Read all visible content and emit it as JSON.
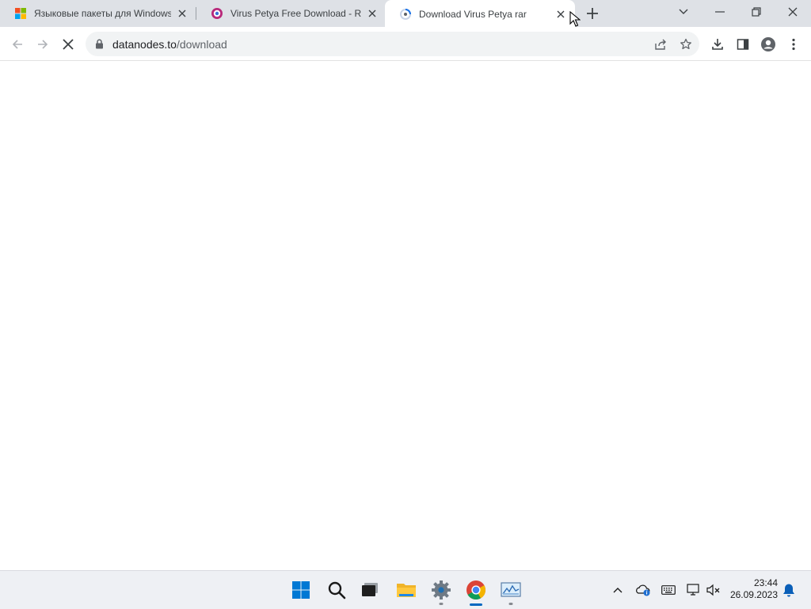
{
  "browser": {
    "tabs": [
      {
        "title": "Языковые пакеты для Windows",
        "active": false,
        "favicon": "windows-logo-icon"
      },
      {
        "title": "Virus Petya Free Download - Rep",
        "active": false,
        "favicon": "site-favicon-icon"
      },
      {
        "title": "Download Virus Petya rar",
        "active": true,
        "favicon": "loading-favicon-icon"
      }
    ],
    "new_tab_icon": "plus-icon",
    "address_bar": {
      "domain": "datanodes.to",
      "path": "/download"
    }
  },
  "taskbar": {
    "apps": [
      "windows-start-icon",
      "search-icon",
      "terminal-icon",
      "file-explorer-icon",
      "settings-icon",
      "chrome-icon",
      "monitor-app-icon"
    ],
    "clock": {
      "time": "23:44",
      "date": "26.09.2023"
    }
  },
  "colors": {
    "tab_strip": "#dee1e6",
    "accent": "#0067c0",
    "omnibox": "#f1f3f4"
  }
}
